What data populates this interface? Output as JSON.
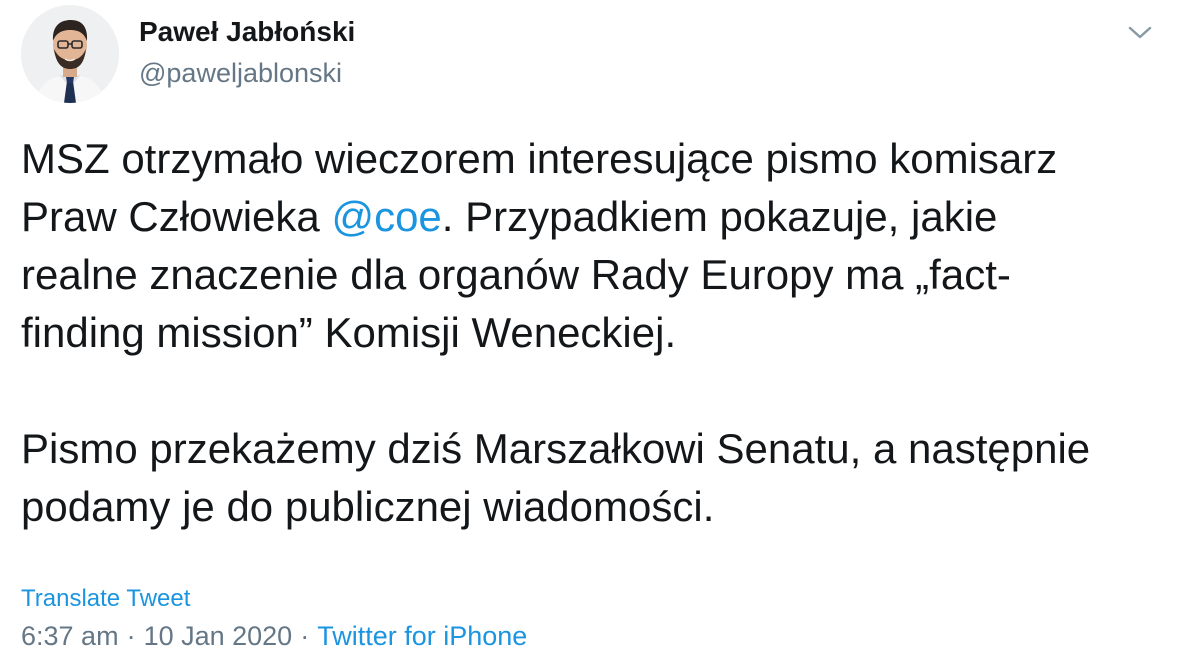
{
  "author": {
    "name": "Paweł Jabłoński",
    "handle": "@paweljablonski"
  },
  "tweet": {
    "paragraph1": {
      "part1": "MSZ otrzymało wieczorem interesujące pismo komisarz",
      "part2": "Praw Człowieka ",
      "mention": "@coe",
      "part3": ". Przypadkiem pokazuje, jakie",
      "part4": "realne znaczenie dla organów Rady Europy ma „fact-",
      "part5": "finding mission” Komisji Weneckiej."
    },
    "paragraph2": {
      "line1": "Pismo przekażemy dziś Marszałkowi Senatu, a następnie",
      "line2": "podamy je do publicznej wiadomości."
    }
  },
  "translate_label": "Translate Tweet",
  "meta": {
    "time": "6:37 am",
    "separator": "·",
    "date": "10 Jan 2020",
    "source": "Twitter for iPhone"
  },
  "colors": {
    "link": "#1b95e0",
    "text": "#14171a",
    "secondary": "#657786"
  },
  "icons": {
    "menu": "chevron-down-icon"
  }
}
